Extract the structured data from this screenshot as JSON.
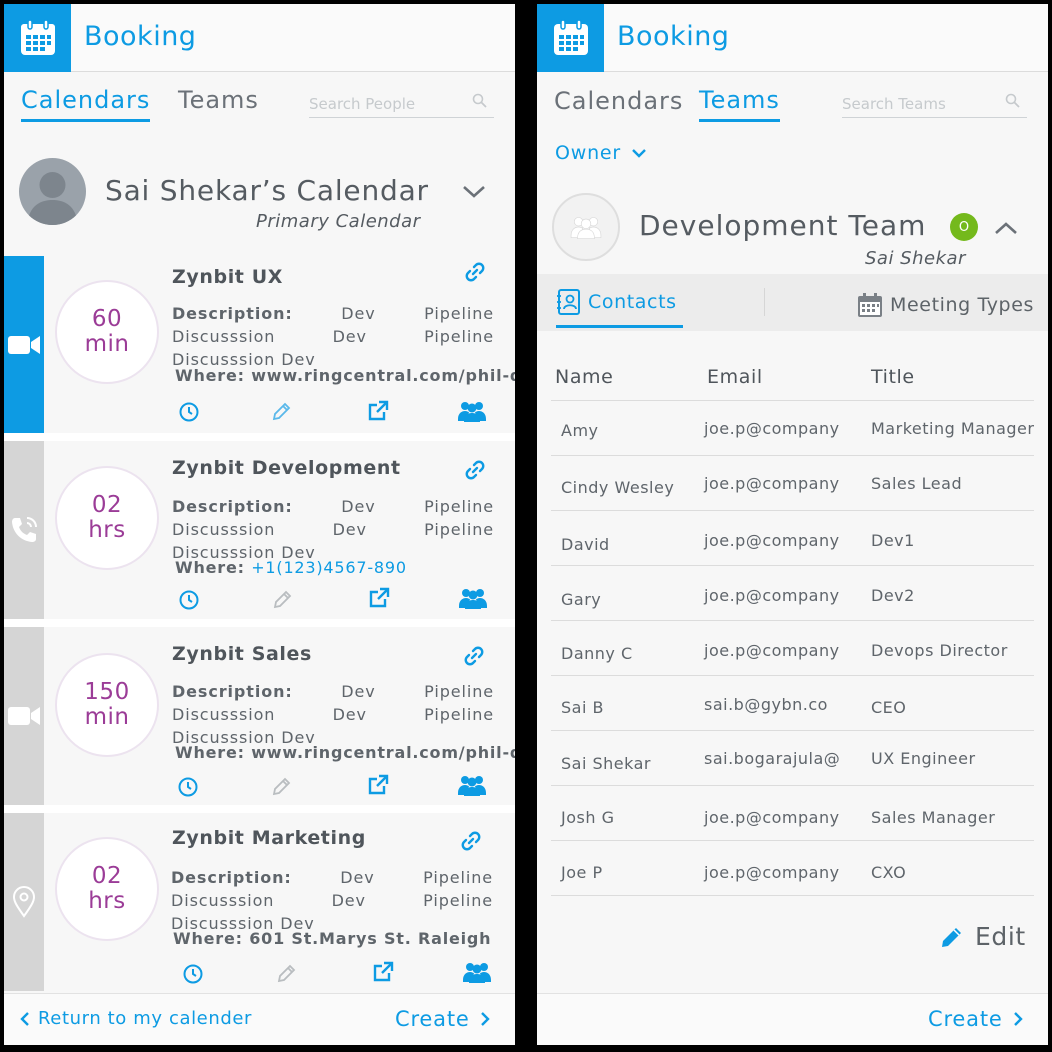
{
  "colors": {
    "accent": "#0d9be3",
    "duration": "#9b3c97",
    "status": "#74b91c"
  },
  "left": {
    "app_title": "Booking",
    "tabs": [
      {
        "label": "Calendars",
        "active": true
      },
      {
        "label": "Teams",
        "active": false
      }
    ],
    "search_placeholder": "Search People",
    "calendar": {
      "title": "Sai Shekar’s Calendar",
      "subtitle": "Primary Calendar"
    },
    "cards": [
      {
        "name": "Zynbit UX",
        "duration": [
          "60",
          "min"
        ],
        "desc_label": "Description:",
        "desc": "Dev Pipeline Discusssion Dev Pipeline Discusssion Dev",
        "where_label": "Where:",
        "where": "www.ringcentral.com/phil-d",
        "type_icon": "video-icon"
      },
      {
        "name": "Zynbit Development",
        "duration": [
          "02",
          "hrs"
        ],
        "desc_label": "Description:",
        "desc": "Dev Pipeline Discusssion Dev Pipeline Discusssion Dev",
        "where_label": "Where:",
        "where": "+1(123)4567-890",
        "type_icon": "phone-icon"
      },
      {
        "name": "Zynbit Sales",
        "duration": [
          "150",
          "min"
        ],
        "desc_label": "Description:",
        "desc": "Dev Pipeline Discusssion Dev Pipeline Discusssion Dev",
        "where_label": "Where:",
        "where": "www.ringcentral.com/phil-d",
        "type_icon": "video-icon"
      },
      {
        "name": "Zynbit Marketing",
        "duration": [
          "02",
          "hrs"
        ],
        "desc_label": "Description:",
        "desc": "Dev Pipeline Discusssion Dev Pipeline Discusssion Dev",
        "where_label": "Where:",
        "where": "601 St.Marys St. Raleigh",
        "type_icon": "location-pin-icon"
      }
    ],
    "footer": {
      "back_label": "Return to my calender",
      "create_label": "Create"
    }
  },
  "right": {
    "app_title": "Booking",
    "tabs": [
      {
        "label": "Calendars",
        "active": false
      },
      {
        "label": "Teams",
        "active": true
      }
    ],
    "search_placeholder": "Search Teams",
    "owner_filter": "Owner",
    "team": {
      "title": "Development Team",
      "owner": "Sai Shekar",
      "status": "O"
    },
    "subtabs": {
      "contacts": "Contacts",
      "meeting_types": "Meeting Types"
    },
    "table": {
      "columns": [
        "Name",
        "Email",
        "Title"
      ],
      "rows": [
        [
          "Amy",
          "joe.p@company",
          "Marketing Manager"
        ],
        [
          "Cindy Wesley",
          "joe.p@company",
          "Sales Lead"
        ],
        [
          "David",
          "joe.p@company",
          "Dev1"
        ],
        [
          "Gary",
          "joe.p@company",
          "Dev2"
        ],
        [
          "Danny C",
          "joe.p@company",
          "Devops Director"
        ],
        [
          "Sai B",
          "sai.b@gybn.co",
          "CEO"
        ],
        [
          "Sai Shekar",
          "sai.bogarajula@",
          "UX Engineer"
        ],
        [
          "Josh G",
          "joe.p@company",
          "Sales Manager"
        ],
        [
          "Joe P",
          "joe.p@company",
          "CXO"
        ]
      ]
    },
    "edit_label": "Edit",
    "footer": {
      "create_label": "Create"
    }
  }
}
